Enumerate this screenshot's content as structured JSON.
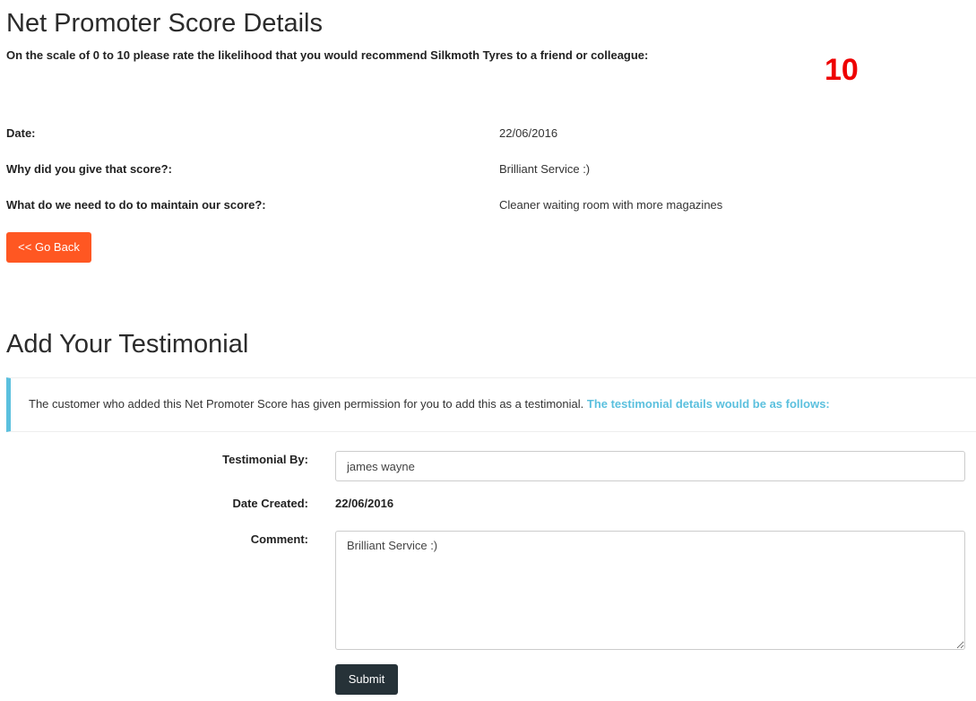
{
  "nps": {
    "title": "Net Promoter Score Details",
    "question": "On the scale of 0 to 10 please rate the likelihood that you would recommend Silkmoth Tyres to a friend or colleague:",
    "score": "10",
    "score_color": "#ee0000",
    "rows": [
      {
        "label": "Date:",
        "value": "22/06/2016"
      },
      {
        "label": "Why did you give that score?:",
        "value": "Brilliant Service :)"
      },
      {
        "label": "What do we need to do to maintain our score?:",
        "value": "Cleaner waiting room with more magazines"
      }
    ],
    "back_button": "<< Go Back",
    "back_button_color": "#ff5722"
  },
  "testimonial": {
    "title": "Add Your Testimonial",
    "callout_text": "The customer who added this Net Promoter Score has given permission for you to add this as a testimonial.",
    "callout_highlight": "The testimonial details would be as follows:",
    "callout_color": "#5bc0de",
    "by_label": "Testimonial By:",
    "by_value": "james wayne",
    "date_label": "Date Created:",
    "date_value": "22/06/2016",
    "comment_label": "Comment:",
    "comment_value": "Brilliant Service :)",
    "submit_button": "Submit",
    "submit_button_color": "#263238"
  }
}
